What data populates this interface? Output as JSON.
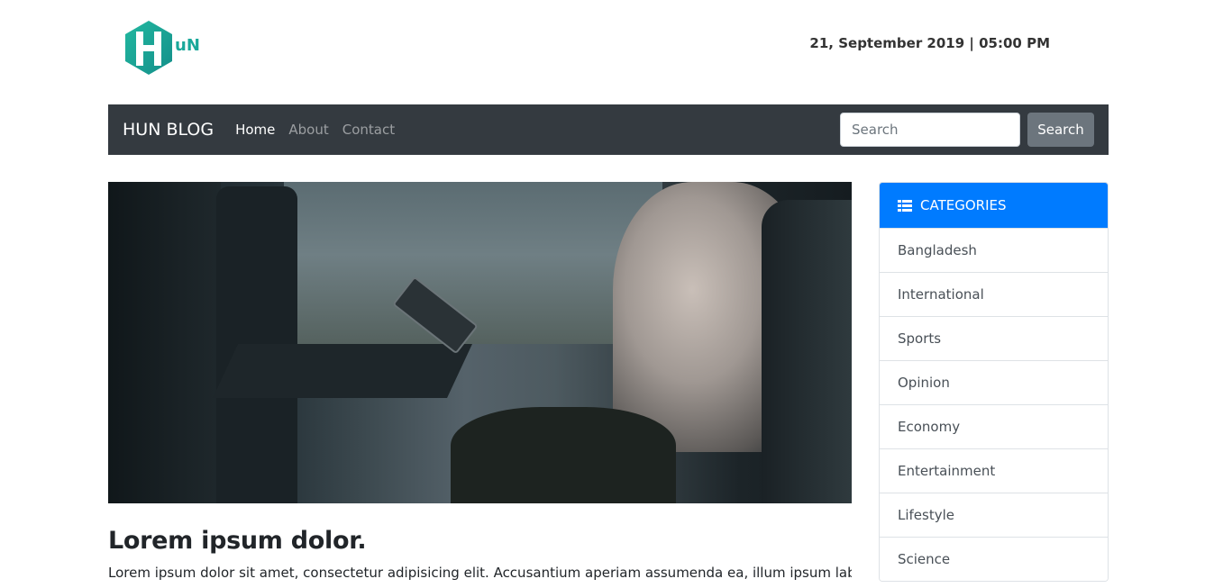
{
  "header": {
    "logo_text": "uN",
    "datetime": "21, September 2019 | 05:00 PM"
  },
  "navbar": {
    "brand": "HUN BLOG",
    "links": [
      "Home",
      "About",
      "Contact"
    ],
    "search_placeholder": "Search",
    "search_button": "Search"
  },
  "post": {
    "title": "Lorem ipsum dolor.",
    "body": "Lorem ipsum dolor sit amet, consectetur adipisicing elit. Accusantium aperiam assumenda ea, illum ipsum laborum"
  },
  "categories": {
    "header": "CATEGORIES",
    "items": [
      "Bangladesh",
      "International",
      "Sports",
      "Opinion",
      "Economy",
      "Entertainment",
      "Lifestyle",
      "Science"
    ]
  },
  "colors": {
    "navbar_bg": "#343a40",
    "primary": "#007bff",
    "logo": "#1aa89a",
    "search_button_bg": "#6c757d"
  }
}
